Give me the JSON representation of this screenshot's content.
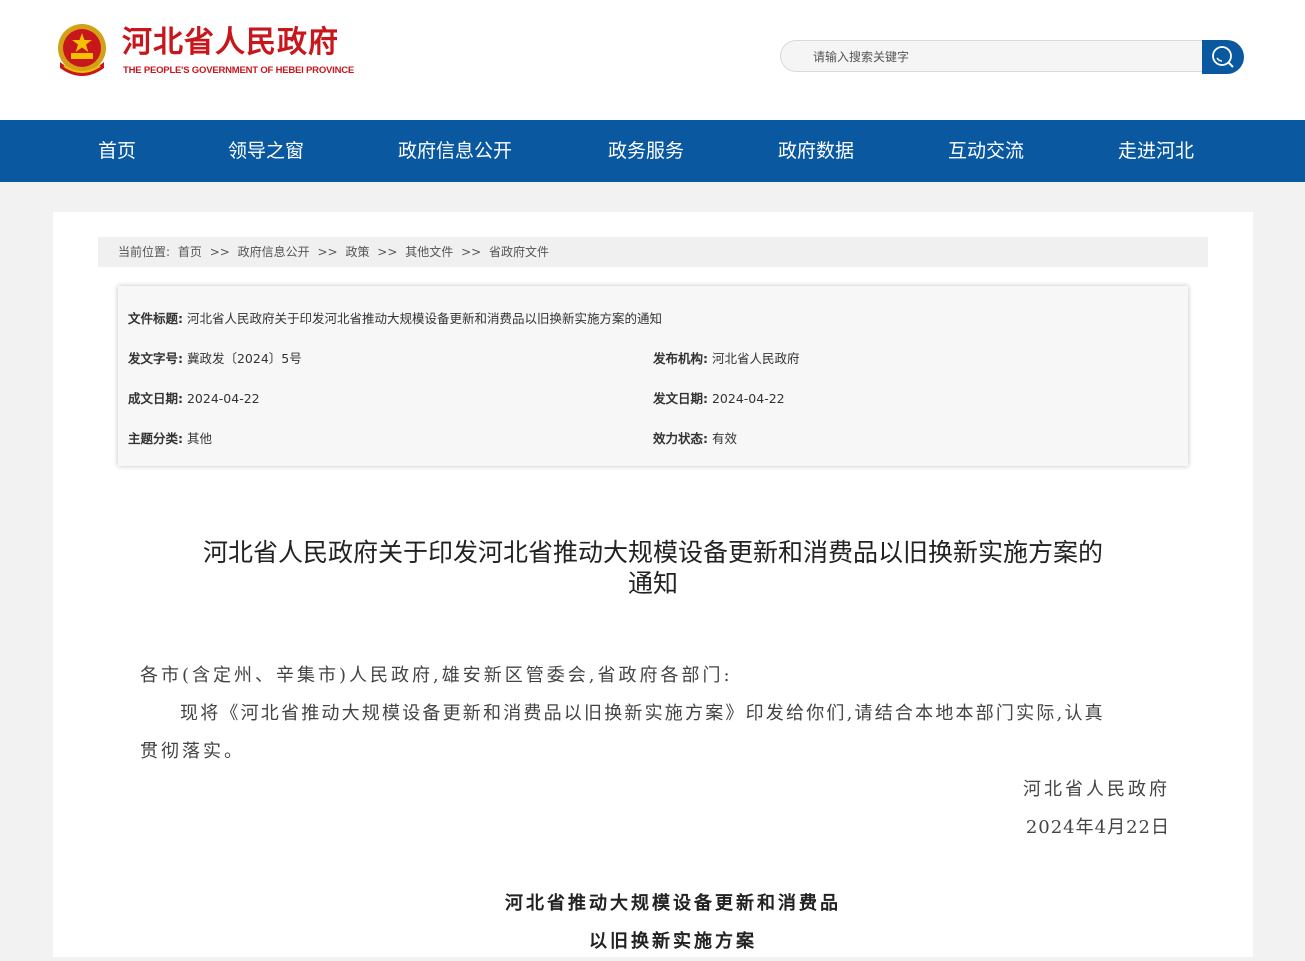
{
  "header": {
    "title": "河北省人民政府",
    "subtitle": "THE PEOPLE'S GOVERNMENT OF HEBEI PROVINCE",
    "search_placeholder": "请输入搜索关键字"
  },
  "nav": [
    "首页",
    "领导之窗",
    "政府信息公开",
    "政务服务",
    "政府数据",
    "互动交流",
    "走进河北"
  ],
  "breadcrumb": {
    "label": "当前位置:",
    "items": [
      "首页",
      "政府信息公开",
      "政策",
      "其他文件",
      "省政府文件"
    ],
    "separator": ">>"
  },
  "info": {
    "title_label": "文件标题:",
    "title_value": "河北省人民政府关于印发河北省推动大规模设备更新和消费品以旧换新实施方案的通知",
    "doc_no_label": "发文字号:",
    "doc_no_value": "冀政发〔2024〕5号",
    "issuer_label": "发布机构:",
    "issuer_value": "河北省人民政府",
    "written_label": "成文日期:",
    "written_value": "2024-04-22",
    "published_label": "发文日期:",
    "published_value": "2024-04-22",
    "category_label": "主题分类:",
    "category_value": "其他",
    "status_label": "效力状态:",
    "status_value": "有效"
  },
  "article": {
    "title_line1": "河北省人民政府关于印发河北省推动大规模设备更新和消费品以旧换新实施方案的",
    "title_line2": "通知",
    "salutation": "各市(含定州、辛集市)人民政府,雄安新区管委会,省政府各部门:",
    "para1_line1": "现将《河北省推动大规模设备更新和消费品以旧换新实施方案》印发给你们,请结合本地本部门实际,认真",
    "para1_line2": "贯彻落实。",
    "signature": "河北省人民政府",
    "date": "2024年4月22日",
    "plan_title_line1": "河北省推动大规模设备更新和消费品",
    "plan_title_line2": "以旧换新实施方案"
  },
  "colors": {
    "brand_red": "#c8161d",
    "nav_blue": "#0a58a0"
  },
  "icons": [
    "national-emblem-icon",
    "search-icon"
  ]
}
